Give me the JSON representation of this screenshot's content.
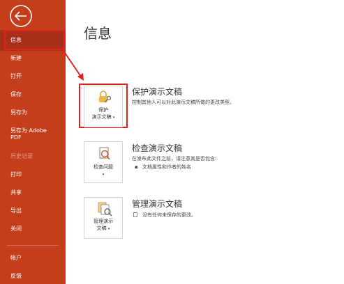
{
  "window": {
    "title": "信息"
  },
  "sidebar": {
    "back_icon": "arrow-left-icon",
    "items": [
      {
        "label": "信息",
        "active": true
      },
      {
        "label": "新建"
      },
      {
        "label": "打开"
      },
      {
        "label": "保存"
      },
      {
        "label": "另存为"
      },
      {
        "label": "另存为 Adobe"
      },
      {
        "label": "PDF"
      },
      {
        "label": "历史记录",
        "disabled": true
      },
      {
        "label": "打印"
      },
      {
        "label": "共享"
      },
      {
        "label": "导出"
      },
      {
        "label": "关闭"
      },
      {
        "label": "帐户"
      },
      {
        "label": "反馈"
      }
    ],
    "color": "#c43e1c"
  },
  "main": {
    "title": "信息",
    "sections": [
      {
        "button_label_1": "保护",
        "button_label_2": "演示文稿",
        "icon": "lock-key-icon",
        "title": "保护演示文稿",
        "description": "控制其他人可以对此演示文稿所做的更改类型。"
      },
      {
        "button_label_1": "检查问题",
        "icon": "inspect-document-icon",
        "title": "检查演示文稿",
        "description": "在发布此文件之前，请注意其是否包含:",
        "bullets": [
          "文档属性和作者的姓名"
        ]
      },
      {
        "button_label_1": "管理演示",
        "button_label_2": "文稿",
        "icon": "manage-versions-icon",
        "title": "管理演示文稿",
        "bullets": [
          "没有任何未保存的更改。"
        ]
      }
    ]
  },
  "annotation_color": "#e0211c"
}
